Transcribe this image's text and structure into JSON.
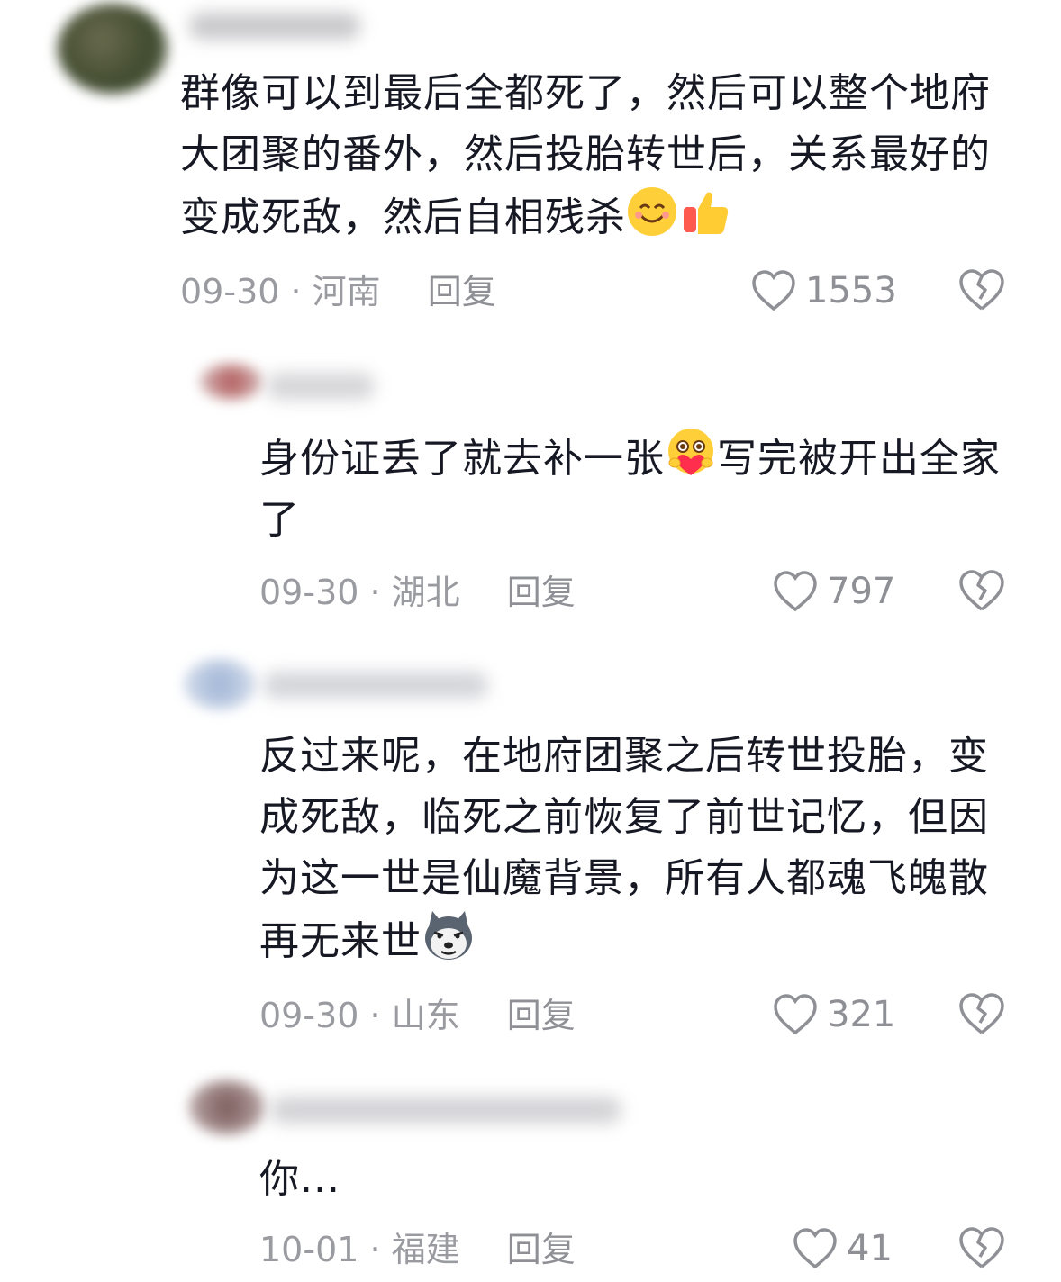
{
  "comments": [
    {
      "text": "群像可以到最后全都死了，然后可以整个地府大团聚的番外，然后投胎转世后，关系最好的变成死敌，然后自相残杀",
      "emojis": [
        "smile-emoji",
        "thumbs-up-emoji"
      ],
      "date": "09-30",
      "location": "河南",
      "reply_label": "回复",
      "likes": "1553"
    },
    {
      "text_before": "身份证丢了就去补一张",
      "text_after": "写完被开出全家了",
      "emojis": [
        "heart-hug-emoji"
      ],
      "date": "09-30",
      "location": "湖北",
      "reply_label": "回复",
      "likes": "797"
    },
    {
      "text": "反过来呢，在地府团聚之后转世投胎，变成死敌，临死之前恢复了前世记忆，但因为这一世是仙魔背景，所有人都魂飞魄散再无来世",
      "emojis": [
        "husky-doge-emoji"
      ],
      "date": "09-30",
      "location": "山东",
      "reply_label": "回复",
      "likes": "321"
    },
    {
      "text": "你...",
      "date": "10-01",
      "location": "福建",
      "reply_label": "回复",
      "likes": "41"
    }
  ],
  "separator": " · ",
  "colors": {
    "text": "#161823",
    "meta": "#9a9ba0"
  }
}
